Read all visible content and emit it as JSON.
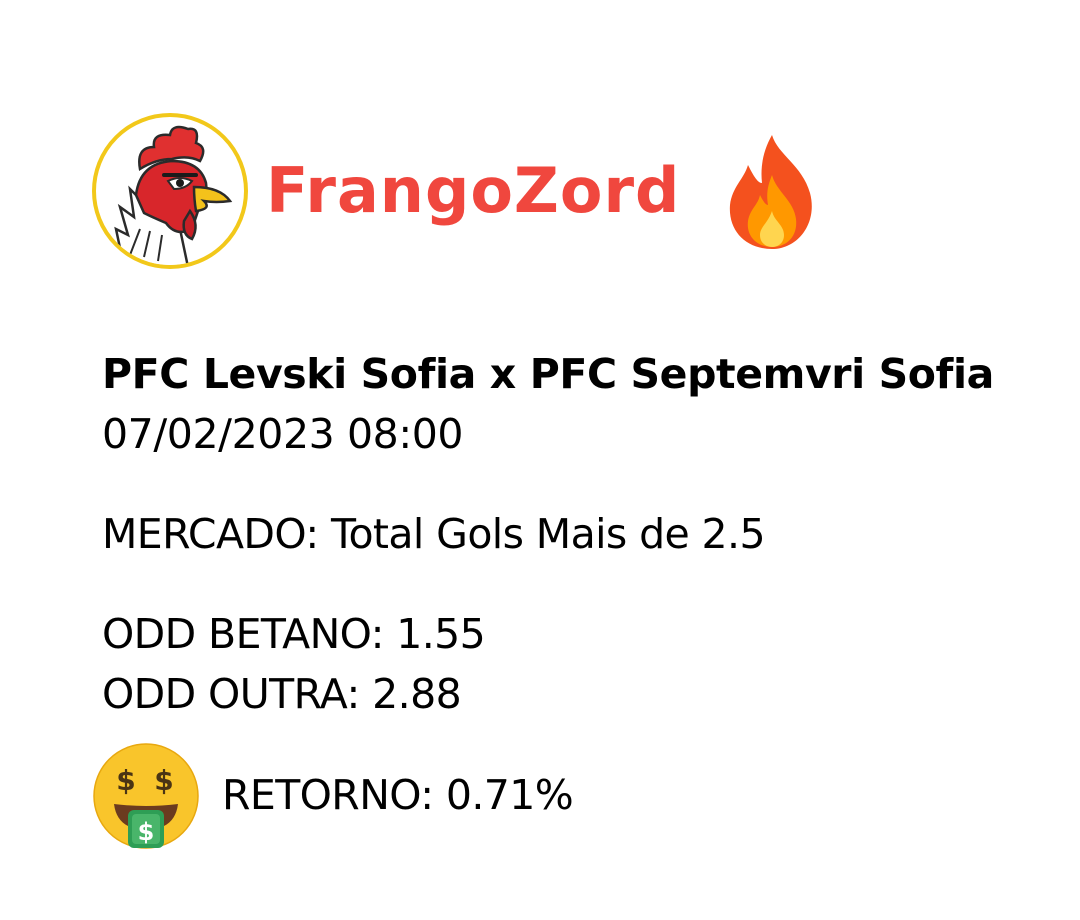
{
  "brand": {
    "name": "FrangoZord",
    "color": "#f0473e",
    "logo_icon": "rooster-icon",
    "badge_icon": "fire-icon"
  },
  "match": {
    "title": "PFC Levski Sofia x PFC Septemvri Sofia",
    "datetime": "07/02/2023 08:00"
  },
  "market": {
    "text": "MERCADO: Total Gols Mais de 2.5"
  },
  "odds": {
    "betano": "ODD BETANO: 1.55",
    "outra": "ODD OUTRA: 2.88"
  },
  "return": {
    "icon": "money-mouth-face-icon",
    "text": "RETORNO: 0.71%"
  }
}
